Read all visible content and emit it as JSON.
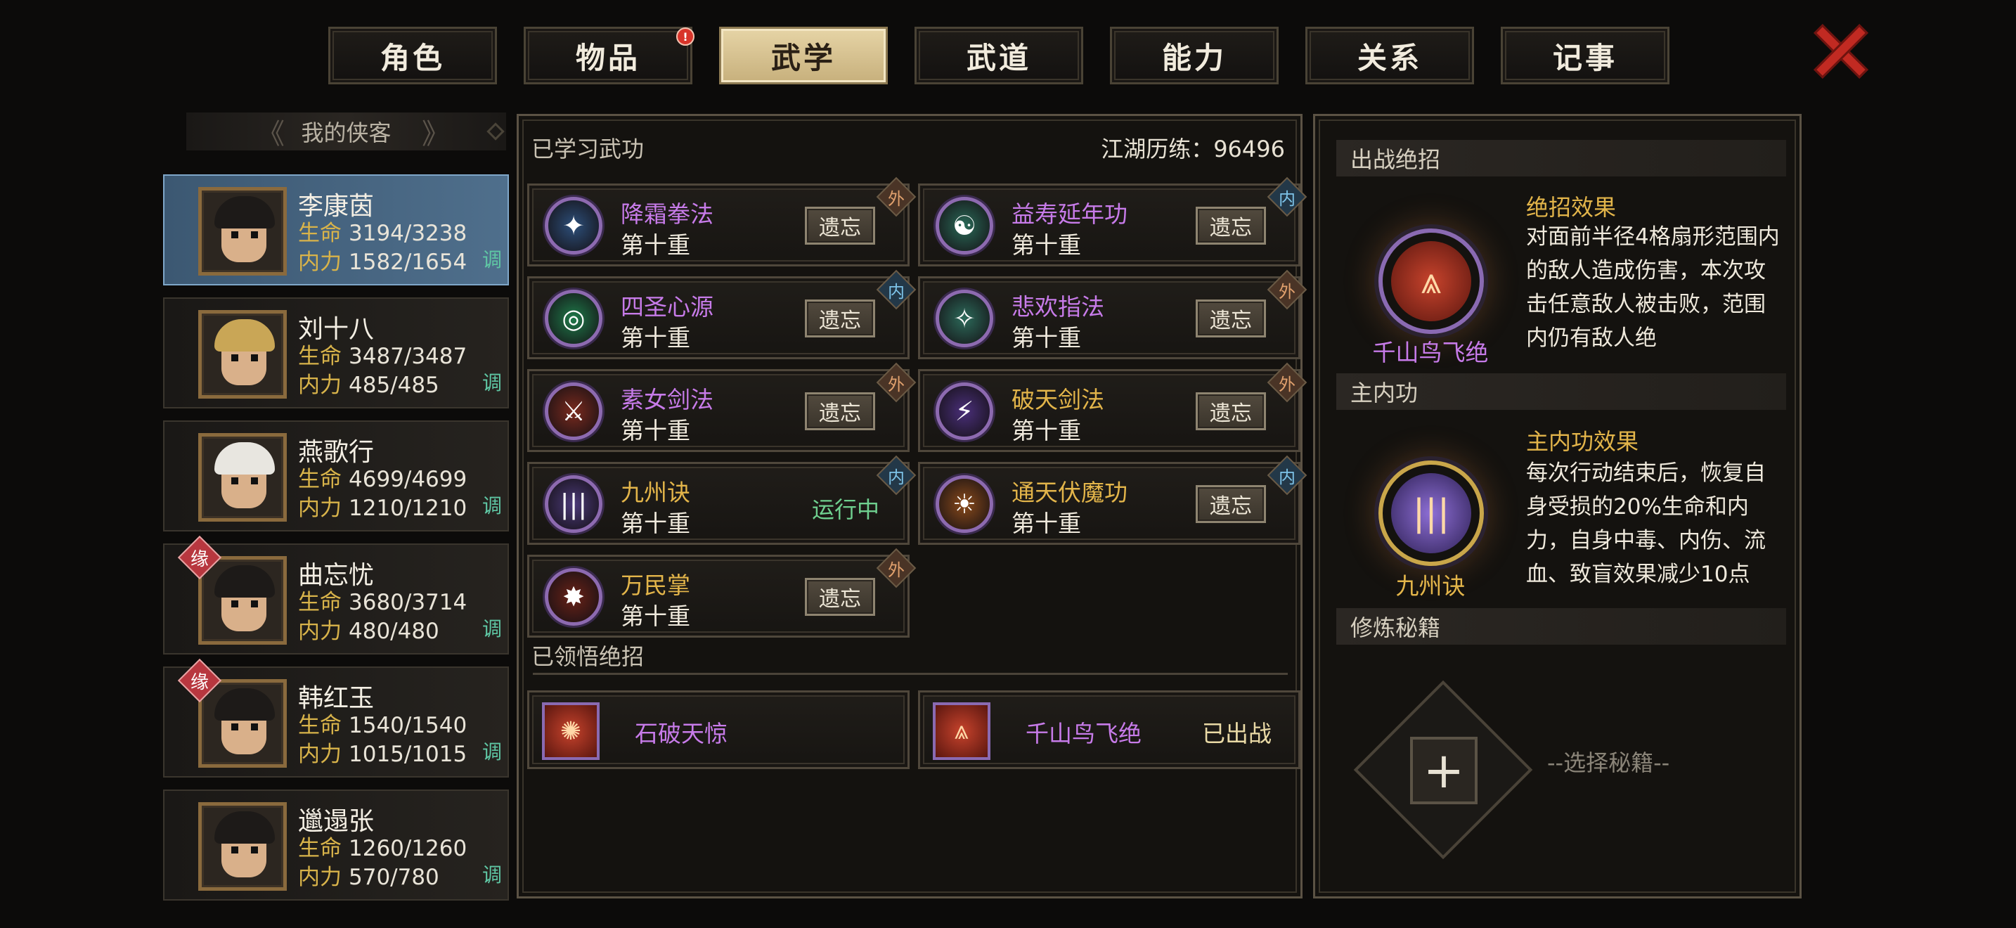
{
  "tabs": [
    {
      "label": "角色",
      "active": false,
      "badge": ""
    },
    {
      "label": "物品",
      "active": false,
      "badge": "!"
    },
    {
      "label": "武学",
      "active": true,
      "badge": ""
    },
    {
      "label": "武道",
      "active": false,
      "badge": ""
    },
    {
      "label": "能力",
      "active": false,
      "badge": ""
    },
    {
      "label": "关系",
      "active": false,
      "badge": ""
    },
    {
      "label": "记事",
      "active": false,
      "badge": ""
    }
  ],
  "close_icon": "close-x-icon",
  "left": {
    "title": "我的侠客",
    "characters": [
      {
        "name": "李康茵",
        "hp_label": "生命",
        "hp": "3194/3238",
        "mp_label": "内力",
        "mp": "1582/1654",
        "adjust": "调",
        "fate": "",
        "selected": true,
        "hair": "dark"
      },
      {
        "name": "刘十八",
        "hp_label": "生命",
        "hp": "3487/3487",
        "mp_label": "内力",
        "mp": "485/485",
        "adjust": "调",
        "fate": "",
        "selected": false,
        "hair": "gold"
      },
      {
        "name": "燕歌行",
        "hp_label": "生命",
        "hp": "4699/4699",
        "mp_label": "内力",
        "mp": "1210/1210",
        "adjust": "调",
        "fate": "",
        "selected": false,
        "hair": "white"
      },
      {
        "name": "曲忘忧",
        "hp_label": "生命",
        "hp": "3680/3714",
        "mp_label": "内力",
        "mp": "480/480",
        "adjust": "调",
        "fate": "缘",
        "selected": false,
        "hair": "dark"
      },
      {
        "name": "韩红玉",
        "hp_label": "生命",
        "hp": "1540/1540",
        "mp_label": "内力",
        "mp": "1015/1015",
        "adjust": "调",
        "fate": "缘",
        "selected": false,
        "hair": "dark"
      },
      {
        "name": "邋遢张",
        "hp_label": "生命",
        "hp": "1260/1260",
        "mp_label": "内力",
        "mp": "570/780",
        "adjust": "调",
        "fate": "",
        "selected": false,
        "hair": "dark"
      }
    ]
  },
  "middle": {
    "learned_title": "已学习武功",
    "exp_label": "江湖历练：96496",
    "skills": [
      {
        "name": "降霜拳法",
        "level": "第十重",
        "type": "外",
        "kind": "wai",
        "action": "遗忘",
        "color": "purple",
        "icon": "frost-fist-icon",
        "glyph": "✦",
        "icon_bg": "#2d4f7a"
      },
      {
        "name": "益寿延年功",
        "level": "第十重",
        "type": "内",
        "kind": "nei",
        "action": "遗忘",
        "color": "purple",
        "icon": "longevity-icon",
        "glyph": "☯",
        "icon_bg": "#2a6a58"
      },
      {
        "name": "四圣心源",
        "level": "第十重",
        "type": "内",
        "kind": "nei",
        "action": "遗忘",
        "color": "purple",
        "icon": "swirl-icon",
        "glyph": "◎",
        "icon_bg": "#1f7a4a"
      },
      {
        "name": "悲欢指法",
        "level": "第十重",
        "type": "外",
        "kind": "wai",
        "action": "遗忘",
        "color": "purple",
        "icon": "finger-strike-icon",
        "glyph": "✧",
        "icon_bg": "#2c6a5a"
      },
      {
        "name": "素女剑法",
        "level": "第十重",
        "type": "外",
        "kind": "wai",
        "action": "遗忘",
        "color": "purple",
        "icon": "sword-icon",
        "glyph": "⚔",
        "icon_bg": "#7a2a1e"
      },
      {
        "name": "破天剑法",
        "level": "第十重",
        "type": "外",
        "kind": "wai",
        "action": "遗忘",
        "color": "gold",
        "icon": "sword-slash-icon",
        "glyph": "⚡",
        "icon_bg": "#4a2f7a"
      },
      {
        "name": "九州诀",
        "level": "第十重",
        "type": "内",
        "kind": "nei",
        "action": "运行中",
        "color": "gold",
        "icon": "pillar-icon",
        "glyph": "|||",
        "icon_bg": "#4c3a7a"
      },
      {
        "name": "通天伏魔功",
        "level": "第十重",
        "type": "内",
        "kind": "nei",
        "action": "遗忘",
        "color": "gold",
        "icon": "flame-icon",
        "glyph": "☀",
        "icon_bg": "#8a4a1a"
      },
      {
        "name": "万民掌",
        "level": "第十重",
        "type": "外",
        "kind": "wai",
        "action": "遗忘",
        "color": "gold",
        "icon": "palm-burst-icon",
        "glyph": "✸",
        "icon_bg": "#6a2218"
      }
    ],
    "ultimate_title": "已领悟绝招",
    "ultimates": [
      {
        "name": "石破天惊",
        "status": "",
        "icon": "rock-burst-icon",
        "glyph": "✺"
      },
      {
        "name": "千山鸟飞绝",
        "status": "已出战",
        "icon": "mountain-icon",
        "glyph": "⩓"
      }
    ]
  },
  "right": {
    "battle_title": "出战绝招",
    "battle_skill": {
      "name": "千山鸟飞绝",
      "effect_title": "绝招效果",
      "effect": "对面前半径4格扇形范围内的敌人造成伤害，本次攻击任意敌人被击败，范围内仍有敌人绝",
      "icon": "mountain-icon",
      "glyph": "⩓"
    },
    "inner_title": "主内功",
    "inner_skill": {
      "name": "九州诀",
      "effect_title": "主内功效果",
      "effect": "每次行动结束后，恢复自身受损的20%生命和内力，自身中毒、内伤、流血、致盲效果减少10点",
      "icon": "pillar-icon",
      "glyph": "|||"
    },
    "secret_title": "修炼秘籍",
    "secret_hint": "--选择秘籍--",
    "add_icon": "plus-icon"
  }
}
